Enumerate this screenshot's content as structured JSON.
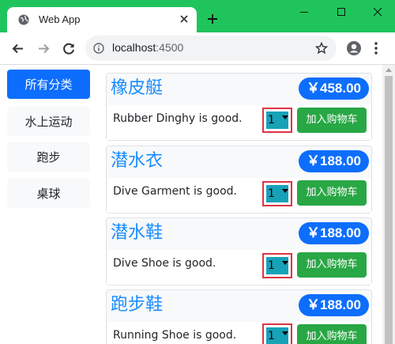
{
  "browser": {
    "tab_title": "Web App",
    "url_host": "localhost",
    "url_port": ":4500"
  },
  "categories": [
    {
      "label": "所有分类",
      "active": true
    },
    {
      "label": "水上运动",
      "active": false
    },
    {
      "label": "跑步",
      "active": false
    },
    {
      "label": "桌球",
      "active": false
    }
  ],
  "products": [
    {
      "name": "橡皮艇",
      "price": "￥458.00",
      "description": "Rubber Dinghy is good.",
      "quantity": "1",
      "button": "加入购物车"
    },
    {
      "name": "潜水衣",
      "price": "￥188.00",
      "description": "Dive Garment is good.",
      "quantity": "1",
      "button": "加入购物车"
    },
    {
      "name": "潜水鞋",
      "price": "￥188.00",
      "description": "Dive Shoe is good.",
      "quantity": "1",
      "button": "加入购物车"
    },
    {
      "name": "跑步鞋",
      "price": "￥188.00",
      "description": "Running Shoe is good.",
      "quantity": "1",
      "button": "加入购物车"
    }
  ],
  "colors": {
    "chrome_green": "#1fc55c",
    "primary": "#0d6efd",
    "success": "#28a745",
    "info": "#17a2b8",
    "danger": "#dc3545"
  },
  "icons": [
    "globe-icon",
    "close-icon",
    "plus-icon",
    "minimize-icon",
    "maximize-icon",
    "back-icon",
    "forward-icon",
    "reload-icon",
    "info-icon",
    "star-icon",
    "profile-icon",
    "menu-icon"
  ]
}
